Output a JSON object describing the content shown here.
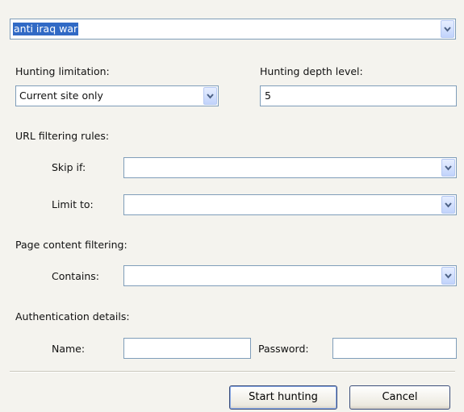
{
  "query": {
    "value": "anti iraq war"
  },
  "hunting_limitation": {
    "label": "Hunting limitation:",
    "value": "Current site only"
  },
  "hunting_depth": {
    "label": "Hunting depth level:",
    "value": "5"
  },
  "url_filtering": {
    "label": "URL filtering rules:",
    "skip_if_label": "Skip if:",
    "skip_if_value": "",
    "limit_to_label": "Limit to:",
    "limit_to_value": ""
  },
  "page_content": {
    "label": "Page content filtering:",
    "contains_label": "Contains:",
    "contains_value": ""
  },
  "authentication": {
    "label": "Authentication details:",
    "name_label": "Name:",
    "name_value": "",
    "password_label": "Password:",
    "password_value": ""
  },
  "buttons": {
    "start": "Start hunting",
    "cancel": "Cancel"
  },
  "icons": {
    "dropdown": "chevron-down-icon"
  },
  "colors": {
    "field_border": "#7f9db9",
    "selection": "#316ac5",
    "dropdown_button": "#c1d3fb"
  }
}
